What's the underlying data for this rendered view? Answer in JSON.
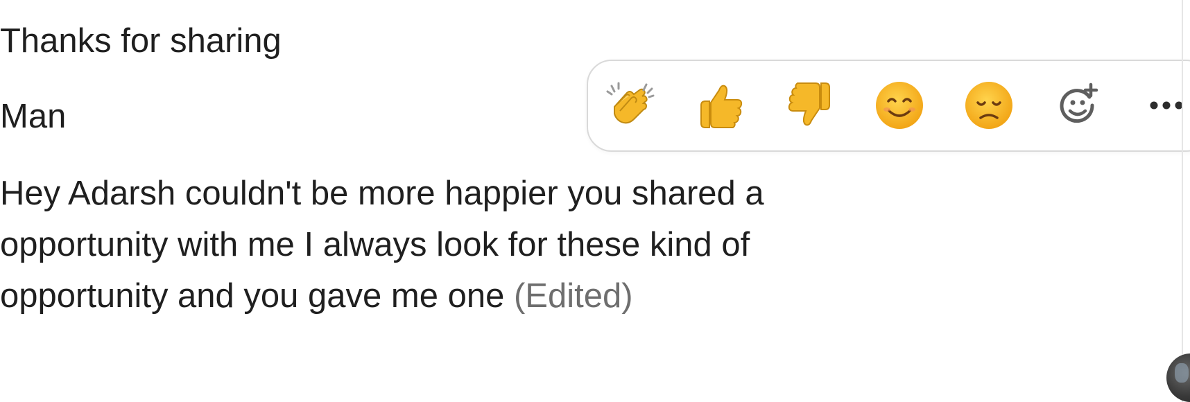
{
  "messages": [
    {
      "text": "Thanks for sharing"
    },
    {
      "text": "Man"
    },
    {
      "text": "Hey Adarsh couldn't be more happier you shared a opportunity with me I always look for these kind of opportunity and you gave me one",
      "edited_label": "(Edited)"
    }
  ],
  "reaction_bar": {
    "reactions": [
      {
        "icon": "clapping-hands-icon"
      },
      {
        "icon": "thumbs-up-icon"
      },
      {
        "icon": "thumbs-down-icon"
      },
      {
        "icon": "smiling-face-icon"
      },
      {
        "icon": "disappointed-face-icon"
      },
      {
        "icon": "add-reaction-icon"
      },
      {
        "icon": "more-options-icon"
      }
    ],
    "emoji_color": "#F5B829",
    "border_color": "#D9D9D9"
  },
  "avatar": {
    "icon": "user-avatar"
  }
}
